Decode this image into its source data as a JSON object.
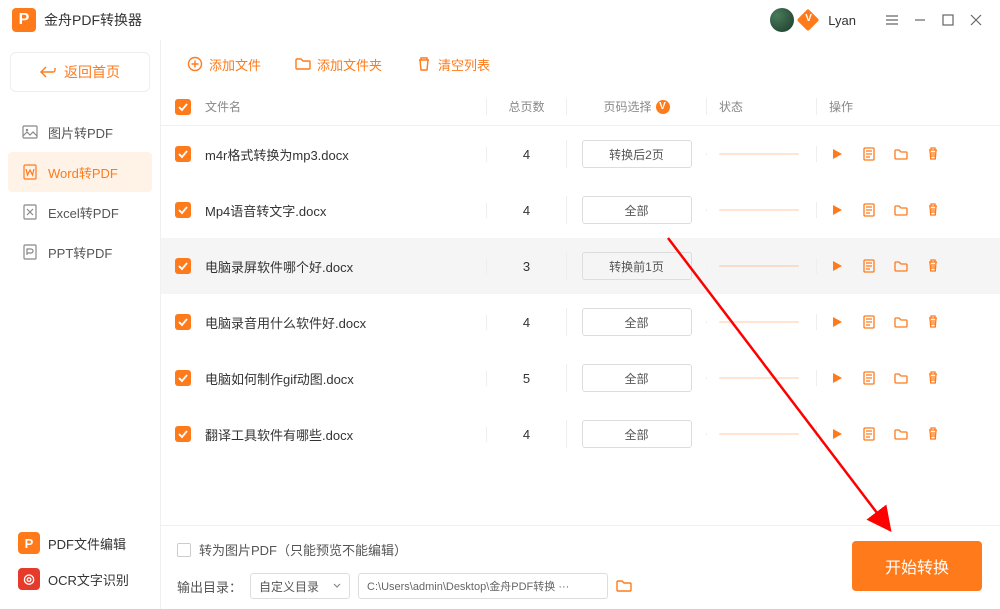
{
  "app": {
    "title": "金舟PDF转换器",
    "username": "Lyan"
  },
  "sidebar": {
    "back": "返回首页",
    "items": [
      {
        "label": "图片转PDF"
      },
      {
        "label": "Word转PDF"
      },
      {
        "label": "Excel转PDF"
      },
      {
        "label": "PPT转PDF"
      }
    ],
    "bottom": [
      {
        "label": "PDF文件编辑"
      },
      {
        "label": "OCR文字识别"
      }
    ]
  },
  "toolbar": {
    "add_file": "添加文件",
    "add_folder": "添加文件夹",
    "clear": "清空列表"
  },
  "table": {
    "headers": {
      "name": "文件名",
      "pages": "总页数",
      "select": "页码选择",
      "status": "状态",
      "ops": "操作"
    },
    "rows": [
      {
        "name": "m4r格式转换为mp3.docx",
        "pages": "4",
        "sel": "转换后2页"
      },
      {
        "name": "Mp4语音转文字.docx",
        "pages": "4",
        "sel": "全部"
      },
      {
        "name": "电脑录屏软件哪个好.docx",
        "pages": "3",
        "sel": "转换前1页"
      },
      {
        "name": "电脑录音用什么软件好.docx",
        "pages": "4",
        "sel": "全部"
      },
      {
        "name": "电脑如何制作gif动图.docx",
        "pages": "5",
        "sel": "全部"
      },
      {
        "name": "翻译工具软件有哪些.docx",
        "pages": "4",
        "sel": "全部"
      }
    ]
  },
  "footer": {
    "to_image": "转为图片PDF（只能预览不能编辑）",
    "out_label": "输出目录：",
    "out_mode": "自定义目录",
    "out_path": "C:\\Users\\admin\\Desktop\\金舟PDF转换 ···",
    "convert": "开始转换"
  }
}
